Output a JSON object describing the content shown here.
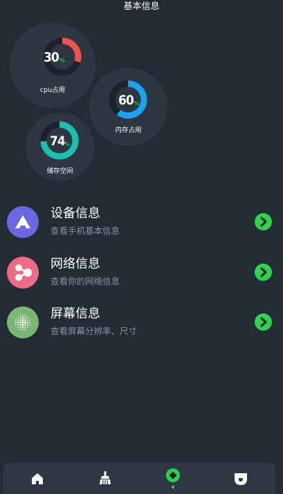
{
  "header": {
    "title": "基本信息"
  },
  "gauges": [
    {
      "id": "cpu",
      "value": "30",
      "unit": "%",
      "label": "cpu占用",
      "percent": 30,
      "color": "#ef5350"
    },
    {
      "id": "memory",
      "value": "60",
      "unit": "%",
      "label": "内存占用",
      "percent": 60,
      "color": "#1aa3f0"
    },
    {
      "id": "storage",
      "value": "74",
      "unit": "%",
      "label": "储存空间",
      "percent": 74,
      "color": "#1cbfb0"
    }
  ],
  "list": [
    {
      "title": "设备信息",
      "subtitle": "查看手机基本信息",
      "icon": "triangle-logo-icon",
      "icon_color": "#6b67e0"
    },
    {
      "title": "网络信息",
      "subtitle": "查看你的网络信息",
      "icon": "network-nodes-icon",
      "icon_color": "#ee6b87"
    },
    {
      "title": "屏幕信息",
      "subtitle": "查看屏幕分辨率、尺寸",
      "icon": "screen-pixels-icon",
      "icon_color": "#7bb674"
    }
  ],
  "tabbar": {
    "tabs": [
      {
        "name": "home-icon",
        "active": false
      },
      {
        "name": "broom-icon",
        "active": false
      },
      {
        "name": "info-diamond-icon",
        "active": true
      },
      {
        "name": "shield-icon",
        "active": false
      }
    ],
    "active_color": "#2fd14e",
    "inactive_color": "#ffffff"
  },
  "colors": {
    "background": "#232b35",
    "card": "#2d3641",
    "accent_green": "#2fd14e"
  }
}
